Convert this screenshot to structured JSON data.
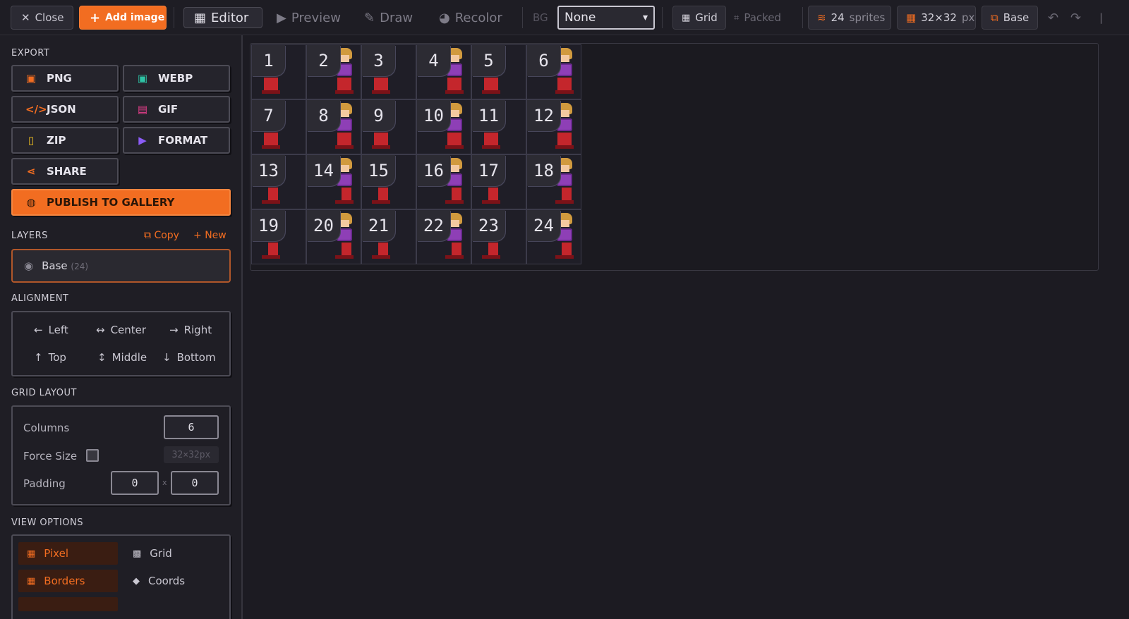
{
  "toolbar": {
    "close_label": "Close",
    "add_image_label": "Add image",
    "tabs": [
      {
        "label": "Editor",
        "icon": "grid-icon"
      },
      {
        "label": "Preview",
        "icon": "play-icon"
      },
      {
        "label": "Draw",
        "icon": "brush-icon"
      },
      {
        "label": "Recolor",
        "icon": "palette-icon"
      }
    ],
    "bg_label": "BG",
    "bg_value": "None",
    "layout_grid": "Grid",
    "layout_packed": "Packed",
    "sprite_count": "24",
    "sprite_unit": "sprites",
    "size": "32×32",
    "size_unit": "px",
    "layer": "Base"
  },
  "sidebar": {
    "export_title": "EXPORT",
    "export_buttons": [
      "PNG",
      "WEBP",
      "JSON",
      "GIF",
      "ZIP",
      "FORMAT",
      "SHARE"
    ],
    "publish_label": "PUBLISH TO GALLERY",
    "layers_title": "LAYERS",
    "layers_copy": "Copy",
    "layers_new": "New",
    "layer_name": "Base",
    "layer_count": "(24)",
    "alignment_title": "ALIGNMENT",
    "alignment": [
      "Left",
      "Center",
      "Right",
      "Top",
      "Middle",
      "Bottom"
    ],
    "grid_layout_title": "GRID LAYOUT",
    "columns_label": "Columns",
    "columns_value": "6",
    "force_size_label": "Force Size",
    "force_size_value": "32×32px",
    "padding_label": "Padding",
    "padding_x": "0",
    "padding_sep": "x",
    "padding_y": "0",
    "view_options_title": "VIEW OPTIONS",
    "view_options": [
      {
        "label": "Pixel",
        "active": true
      },
      {
        "label": "Grid",
        "active": false
      },
      {
        "label": "Borders",
        "active": true
      },
      {
        "label": "Coords",
        "active": false
      }
    ]
  },
  "sheet": {
    "cells": [
      "1",
      "2",
      "3",
      "4",
      "5",
      "6",
      "7",
      "8",
      "9",
      "10",
      "11",
      "12",
      "13",
      "14",
      "15",
      "16",
      "17",
      "18",
      "19",
      "20",
      "21",
      "22",
      "23",
      "24"
    ]
  },
  "colors": {
    "accent": "#f26d21",
    "background": "#1c1b22"
  }
}
